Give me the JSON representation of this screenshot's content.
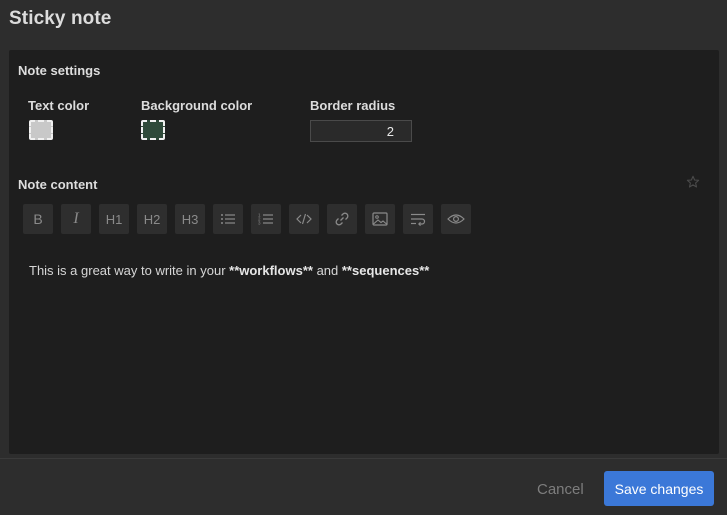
{
  "dialog": {
    "title": "Sticky note"
  },
  "settings": {
    "section_title": "Note settings",
    "text_color_label": "Text color",
    "text_color_value": "#c8c8c8",
    "background_color_label": "Background color",
    "background_color_value": "#2f4a3a",
    "border_radius_label": "Border radius",
    "border_radius_value": "2"
  },
  "content": {
    "section_title": "Note content",
    "favorite_icon": "star-icon",
    "toolbar": [
      {
        "name": "bold",
        "label": "B",
        "icon": "bold-icon"
      },
      {
        "name": "italic",
        "label": "I",
        "icon": "italic-icon"
      },
      {
        "name": "heading-1",
        "label": "H1",
        "icon": "heading-1-icon"
      },
      {
        "name": "heading-2",
        "label": "H2",
        "icon": "heading-2-icon"
      },
      {
        "name": "heading-3",
        "label": "H3",
        "icon": "heading-3-icon"
      },
      {
        "name": "bullet-list",
        "icon": "bullet-list-icon"
      },
      {
        "name": "numbered-list",
        "icon": "numbered-list-icon"
      },
      {
        "name": "code",
        "icon": "code-icon"
      },
      {
        "name": "link",
        "icon": "link-icon"
      },
      {
        "name": "image",
        "icon": "image-icon"
      },
      {
        "name": "wrap",
        "icon": "text-wrap-icon"
      },
      {
        "name": "preview",
        "icon": "eye-icon"
      }
    ],
    "text_before": "This is a great way to write in your ",
    "text_bold_1": "**workflows**",
    "text_middle": " and ",
    "text_bold_2": "**sequences**"
  },
  "footer": {
    "cancel_label": "Cancel",
    "save_label": "Save changes"
  },
  "colors": {
    "accent": "#3b78d8",
    "panel": "#1e1e1e",
    "background": "#2d2d2d"
  }
}
